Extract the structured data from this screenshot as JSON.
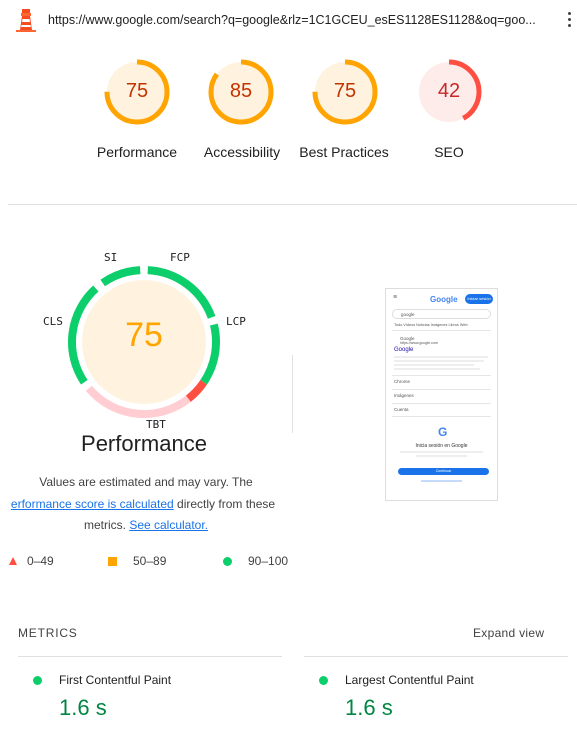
{
  "header": {
    "url": "https://www.google.com/search?q=google&rlz=1C1GCEU_esES1128ES1128&oq=goo..."
  },
  "categories": [
    {
      "score": "75",
      "label": "Performance",
      "fraction": 0.75,
      "color": "#ffa400",
      "bg": "#fff3e0",
      "text_color": "#c33300"
    },
    {
      "score": "85",
      "label": "Accessibility",
      "fraction": 0.85,
      "color": "#ffa400",
      "bg": "#fff3e0",
      "text_color": "#c33300"
    },
    {
      "score": "75",
      "label": "Best Practices",
      "fraction": 0.75,
      "color": "#ffa400",
      "bg": "#fff3e0",
      "text_color": "#c33300"
    },
    {
      "score": "42",
      "label": "SEO",
      "fraction": 0.42,
      "color": "#ff4e42",
      "bg": "#fdecea",
      "text_color": "#c62828"
    }
  ],
  "performance": {
    "score": "75",
    "title": "Performance",
    "metric_tags": {
      "si": "SI",
      "fcp": "FCP",
      "lcp": "LCP",
      "tbt": "TBT",
      "cls": "CLS"
    },
    "note_text_1": "Values are estimated and may vary. The",
    "note_link_1": "erformance score is calculated",
    "note_text_2": "directly from these",
    "note_text_3": "metrics.",
    "note_link_2": "See calculator."
  },
  "legend": {
    "fail": "0–49",
    "average": "50–89",
    "pass": "90–100"
  },
  "screenshot": {
    "logo": "Google",
    "signin_button": "Iniciar sesión",
    "search_value": "google",
    "tabs": "Todo   Vídeos   Noticias   Imágenes   Libros   Web",
    "result_title": "Google",
    "result_url": "https://www.google.com",
    "items": [
      "Chrome",
      "Imágenes",
      "Cuenta"
    ],
    "signin_title": "Inicia sesión en Google",
    "continue_label": "Continuar"
  },
  "metrics": {
    "heading": "METRICS",
    "expand_label": "Expand view",
    "items": [
      {
        "name": "First Contentful Paint",
        "value": "1.6 s"
      },
      {
        "name": "Largest Contentful Paint",
        "value": "1.6 s"
      }
    ]
  },
  "colors": {
    "pass": "#0cce6b",
    "average": "#ffa400",
    "fail": "#ff4e42",
    "link": "#1a73e8"
  }
}
